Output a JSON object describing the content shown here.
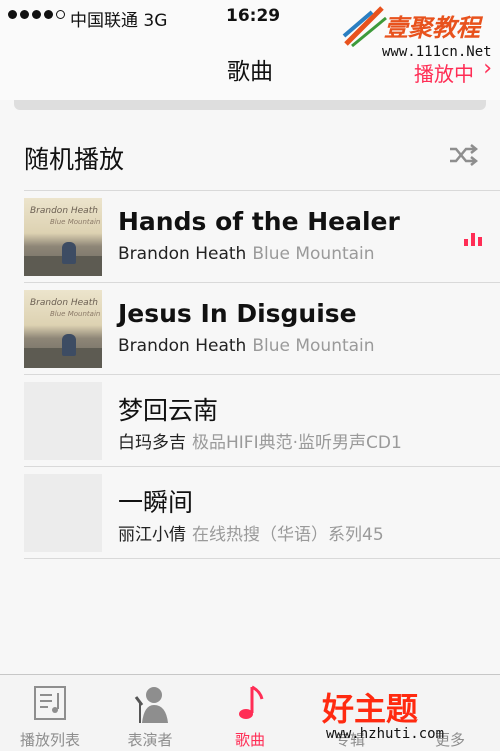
{
  "status_bar": {
    "carrier": "中国联通  3G",
    "time": "16:29"
  },
  "nav": {
    "title": "歌曲",
    "now_playing": "播放中"
  },
  "logo": {
    "text": "壹聚教程",
    "url": "www.111cn.Net"
  },
  "shuffle": {
    "label": "随机播放",
    "icon": "shuffle-icon"
  },
  "songs": [
    {
      "title": "Hands of the Healer",
      "artist": "Brandon Heath",
      "album": "Blue Mountain",
      "art": "Brandon Heath Blue Mountain",
      "playing": true
    },
    {
      "title": "Jesus In Disguise",
      "artist": "Brandon Heath",
      "album": "Blue Mountain",
      "art": "Brandon Heath Blue Mountain",
      "playing": false
    },
    {
      "title": "梦回云南",
      "artist": "白玛多吉",
      "album": "极品HIFI典范·监听男声CD1",
      "art": "",
      "playing": false
    },
    {
      "title": "一瞬间",
      "artist": "丽江小倩",
      "album": "在线热搜（华语）系列45",
      "art": "",
      "playing": false
    }
  ],
  "tabs": [
    {
      "label": "播放列表",
      "icon": "playlist-icon",
      "active": false
    },
    {
      "label": "表演者",
      "icon": "artist-icon",
      "active": false
    },
    {
      "label": "歌曲",
      "icon": "music-note-icon",
      "active": true
    },
    {
      "label": "专辑",
      "icon": "album-icon",
      "active": false
    },
    {
      "label": "更多",
      "icon": "more-icon",
      "active": false
    }
  ],
  "watermark": {
    "text": "好主题",
    "url": "www.hzhuti.com"
  },
  "colors": {
    "accent": "#ff2d55",
    "background": "#f7f7f7",
    "separator": "#d9d9d9",
    "secondary_text": "#9a9a9a"
  }
}
